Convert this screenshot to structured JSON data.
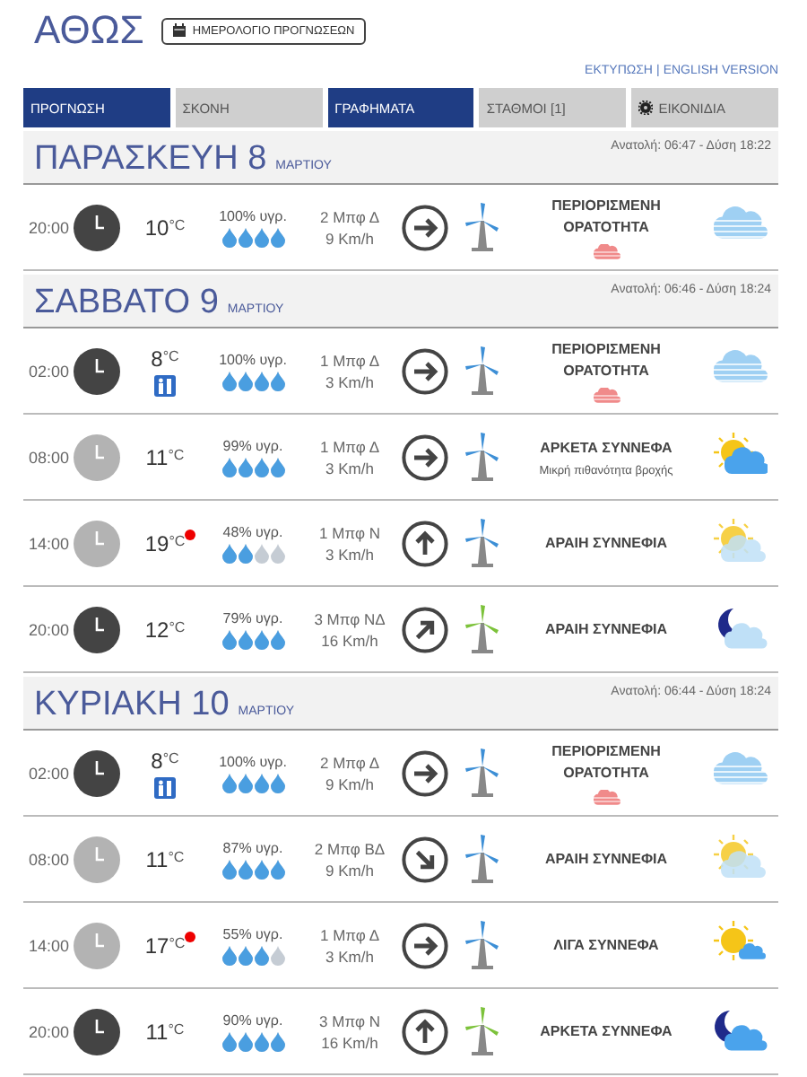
{
  "header": {
    "title": "ΑΘΩΣ",
    "calendar_button": "ΗΜΕΡΟΛΟΓΙΟ ΠΡΟΓΝΩΣΕΩΝ",
    "links": [
      "ΕΚΤΥΠΩΣΗ",
      "ENGLISH VERSION"
    ],
    "separator": "|"
  },
  "tabs": [
    {
      "label": "ΠΡΟΓΝΩΣΗ",
      "selected": true,
      "kind": "text"
    },
    {
      "label": "ΣΚΟΝΗ",
      "selected": false,
      "kind": "text"
    },
    {
      "label": "ΓΡΑΦΗΜΑΤΑ",
      "selected": true,
      "kind": "text"
    },
    {
      "label": "ΣΤΑΘΜΟΙ  [1]",
      "selected": false,
      "kind": "text"
    },
    {
      "label": "ΕΙΚΟΝΙΔΙΑ",
      "selected": false,
      "kind": "gear"
    }
  ],
  "days": [
    {
      "day": "ΠΑΡΑΣΚΕΥΗ 8",
      "month": "ΜΑΡΤΙΟΥ",
      "sun": "Ανατολή: 06:47 - Δύση 18:22",
      "rows": [
        {
          "time": "20:00",
          "night": true,
          "temp": "10",
          "unit": "°C",
          "hot": false,
          "alert": false,
          "humidity": "100% υγρ.",
          "level": 1,
          "wind": "2 Μπφ Δ",
          "speed": "9 Km/h",
          "arrow": {
            "kind": "right"
          },
          "turbine": {
            "kind": "light"
          },
          "condition": "ΠΕΡΙΟΡΙΣΜΕΝΗ ΟΡΑΤΟΤΗΤΑ",
          "warning": true,
          "weather": {
            "kind": "fog"
          }
        }
      ]
    },
    {
      "day": "ΣΑΒΒΑΤΟ 9",
      "month": "ΜΑΡΤΙΟΥ",
      "sun": "Ανατολή: 06:46 - Δύση 18:24",
      "rows": [
        {
          "time": "02:00",
          "night": true,
          "temp": "8",
          "unit": "°C",
          "hot": false,
          "alert": true,
          "humidity": "100% υγρ.",
          "level": 1,
          "wind": "1 Μπφ Δ",
          "speed": "3 Km/h",
          "arrow": {
            "kind": "right"
          },
          "turbine": {
            "kind": "light"
          },
          "condition": "ΠΕΡΙΟΡΙΣΜΕΝΗ ΟΡΑΤΟΤΗΤΑ",
          "warning": true,
          "weather": {
            "kind": "fog"
          }
        },
        {
          "time": "08:00",
          "night": false,
          "temp": "11",
          "unit": "°C",
          "hot": false,
          "alert": false,
          "humidity": "99% υγρ.",
          "level": 1,
          "wind": "1 Μπφ Δ",
          "speed": "3 Km/h",
          "arrow": {
            "kind": "right"
          },
          "turbine": {
            "kind": "light"
          },
          "condition": "ΑΡΚΕΤΑ ΣΥΝΝΕΦΑ",
          "note": "Μικρή πιθανότητα βροχής",
          "warning": false,
          "weather": {
            "kind": "sun-cloud"
          }
        },
        {
          "time": "14:00",
          "night": false,
          "temp": "19",
          "unit": "°C",
          "hot": true,
          "alert": false,
          "humidity": "48% υγρ.",
          "level": 0.5,
          "wind": "1 Μπφ Ν",
          "speed": "3 Km/h",
          "arrow": {
            "kind": "up"
          },
          "turbine": {
            "kind": "light"
          },
          "condition": "ΑΡΑΙΗ ΣΥΝΝΕΦΙΑ",
          "warning": false,
          "weather": {
            "kind": "hazy-sun"
          }
        },
        {
          "time": "20:00",
          "night": true,
          "temp": "12",
          "unit": "°C",
          "hot": false,
          "alert": false,
          "humidity": "79% υγρ.",
          "level": 1,
          "wind": "3 Μπφ ΝΔ",
          "speed": "16 Km/h",
          "arrow": {
            "kind": "up-right"
          },
          "turbine": {
            "kind": "moderate"
          },
          "condition": "ΑΡΑΙΗ ΣΥΝΝΕΦΙΑ",
          "warning": false,
          "weather": {
            "kind": "moon-pale"
          }
        }
      ]
    },
    {
      "day": "ΚΥΡΙΑΚΗ 10",
      "month": "ΜΑΡΤΙΟΥ",
      "sun": "Ανατολή: 06:44 - Δύση 18:24",
      "rows": [
        {
          "time": "02:00",
          "night": true,
          "temp": "8",
          "unit": "°C",
          "hot": false,
          "alert": true,
          "humidity": "100% υγρ.",
          "level": 1,
          "wind": "2 Μπφ Δ",
          "speed": "9 Km/h",
          "arrow": {
            "kind": "right"
          },
          "turbine": {
            "kind": "light"
          },
          "condition": "ΠΕΡΙΟΡΙΣΜΕΝΗ ΟΡΑΤΟΤΗΤΑ",
          "warning": true,
          "weather": {
            "kind": "fog"
          }
        },
        {
          "time": "08:00",
          "night": false,
          "temp": "11",
          "unit": "°C",
          "hot": false,
          "alert": false,
          "humidity": "87% υγρ.",
          "level": 1,
          "wind": "2 Μπφ ΒΔ",
          "speed": "9 Km/h",
          "arrow": {
            "kind": "down-right"
          },
          "turbine": {
            "kind": "light"
          },
          "condition": "ΑΡΑΙΗ ΣΥΝΝΕΦΙΑ",
          "warning": false,
          "weather": {
            "kind": "hazy-sun"
          }
        },
        {
          "time": "14:00",
          "night": false,
          "temp": "17",
          "unit": "°C",
          "hot": true,
          "alert": false,
          "humidity": "55% υγρ.",
          "level": 0.75,
          "wind": "1 Μπφ Δ",
          "speed": "3 Km/h",
          "arrow": {
            "kind": "right"
          },
          "turbine": {
            "kind": "light"
          },
          "condition": "ΛΙΓΑ ΣΥΝΝΕΦΑ",
          "warning": false,
          "weather": {
            "kind": "sun-small-cloud"
          }
        },
        {
          "time": "20:00",
          "night": true,
          "temp": "11",
          "unit": "°C",
          "hot": false,
          "alert": false,
          "humidity": "90% υγρ.",
          "level": 1,
          "wind": "3 Μπφ Ν",
          "speed": "16 Km/h",
          "arrow": {
            "kind": "up"
          },
          "turbine": {
            "kind": "moderate"
          },
          "condition": "ΑΡΚΕΤΑ ΣΥΝΝΕΦΑ",
          "warning": false,
          "weather": {
            "kind": "moon-cloud"
          }
        }
      ]
    }
  ]
}
